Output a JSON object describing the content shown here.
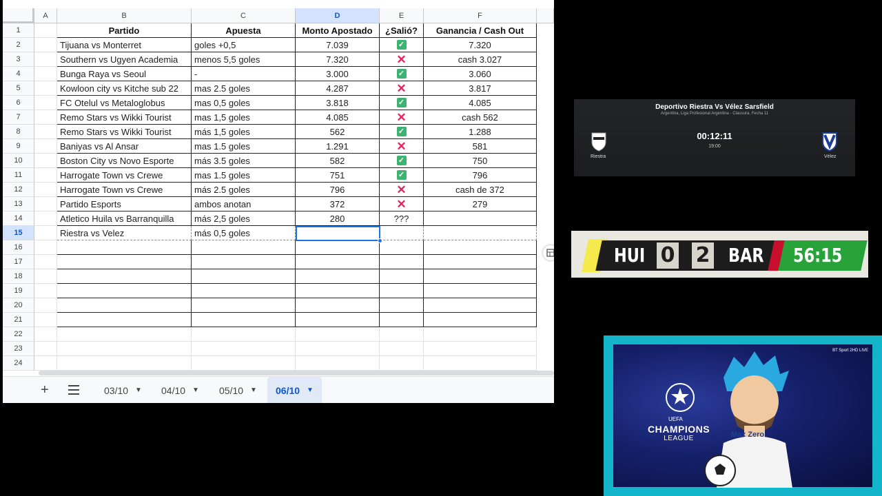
{
  "sheet": {
    "columns": [
      "A",
      "B",
      "C",
      "D",
      "E",
      "F"
    ],
    "active_column": "D",
    "active_row": "15",
    "row_numbers": [
      "1",
      "2",
      "3",
      "4",
      "5",
      "6",
      "7",
      "8",
      "9",
      "10",
      "11",
      "12",
      "13",
      "14",
      "15",
      "16",
      "17",
      "18",
      "19",
      "20",
      "21",
      "22",
      "23",
      "24"
    ],
    "headers": {
      "partido": "Partido",
      "apuesta": "Apuesta",
      "monto": "Monto Apostado",
      "salio": "¿Salió?",
      "ganancia": "Ganancia / Cash Out"
    },
    "rows": [
      {
        "partido": "Tijuana vs Monterret",
        "apuesta": "goles +0,5",
        "monto": "7.039",
        "salio": "check",
        "ganancia": "7.320"
      },
      {
        "partido": "Southern vs Ugyen Academia",
        "apuesta": "menos 5,5 goles",
        "monto": "7.320",
        "salio": "cross",
        "ganancia": "cash 3.027"
      },
      {
        "partido": "Bunga Raya vs Seoul",
        "apuesta": "-",
        "monto": "3.000",
        "salio": "check",
        "ganancia": "3.060"
      },
      {
        "partido": "Kowloon city vs Kitche sub 22",
        "apuesta": "mas 2.5 goles",
        "monto": "4.287",
        "salio": "cross",
        "ganancia": "3.817"
      },
      {
        "partido": "FC Otelul vs Metaloglobus",
        "apuesta": "mas 0,5 goles",
        "monto": "3.818",
        "salio": "check",
        "ganancia": "4.085"
      },
      {
        "partido": "Remo Stars vs Wikki Tourist",
        "apuesta": "mas 1,5 goles",
        "monto": "4.085",
        "salio": "cross",
        "ganancia": "cash 562"
      },
      {
        "partido": "Remo Stars vs Wikki Tourist",
        "apuesta": "más 1,5 goles",
        "monto": "562",
        "salio": "check",
        "ganancia": "1.288"
      },
      {
        "partido": "Baniyas vs Al Ansar",
        "apuesta": "mas 1.5 goles",
        "monto": "1.291",
        "salio": "cross",
        "ganancia": "581"
      },
      {
        "partido": "Boston City vs Novo Esporte",
        "apuesta": "más 3.5 goles",
        "monto": "582",
        "salio": "check",
        "ganancia": "750"
      },
      {
        "partido": "Harrogate Town vs Crewe",
        "apuesta": "mas 1.5 goles",
        "monto": "751",
        "salio": "check",
        "ganancia": "796"
      },
      {
        "partido": "Harrogate Town vs Crewe",
        "apuesta": "más 2.5 goles",
        "monto": "796",
        "salio": "cross",
        "ganancia": "cash de 372"
      },
      {
        "partido": "Partido Esports",
        "apuesta": "ambos anotan",
        "monto": "372",
        "salio": "cross",
        "ganancia": "279"
      },
      {
        "partido": "Atletico Huila vs Barranquilla",
        "apuesta": "más 2,5 goles",
        "monto": "280",
        "salio": "???",
        "ganancia": ""
      },
      {
        "partido": "Riestra vs Velez",
        "apuesta": "más 0,5 goles",
        "monto": "",
        "salio": "",
        "ganancia": ""
      }
    ],
    "tabs": [
      "03/10",
      "04/10",
      "05/10",
      "06/10"
    ],
    "active_tab": "06/10",
    "add_sheet_label": "+"
  },
  "scoreboard": {
    "title": "Deportivo Riestra Vs Vélez Sarsfield",
    "league": "Argentina, Liga Profesional Argentina - Clausura, Fecha 11",
    "clock": "00:12:11",
    "kickoff": "19:00",
    "home_team": "Riestra",
    "away_team": "Vélez",
    "home_color": "#ffffff",
    "away_color": "#1d3f95"
  },
  "live_ribbon": {
    "home": "HUI",
    "home_score": "0",
    "away_score": "2",
    "away": "BAR",
    "time": "56:15",
    "time_color": "#27a33a"
  },
  "overlay": {
    "competition_top": "UEFA",
    "competition_main": "CHAMPIONS",
    "competition_sub": "LEAGUE",
    "broadcaster": "BT Sport 2HD LIVE",
    "shirt_text": "Max Zero",
    "frame_color": "#12b5c9"
  }
}
